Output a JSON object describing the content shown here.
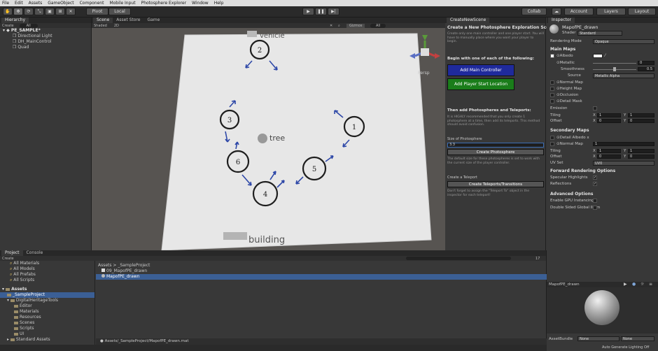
{
  "menu": [
    "File",
    "Edit",
    "Assets",
    "GameObject",
    "Component",
    "Mobile Input",
    "Photosphere Explorer",
    "Window",
    "Help"
  ],
  "toolbar": {
    "pivot": "Pivot",
    "local": "Local",
    "collab": "Collab",
    "account": "Account",
    "layers": "Layers",
    "layout": "Layout"
  },
  "hierarchy": {
    "tab": "Hierarchy",
    "create": "Create",
    "search": "All",
    "scene": "PE_SAMPLE*",
    "items": [
      "Directional Light",
      "DH_MainControl",
      "Quad"
    ]
  },
  "scene": {
    "tabs": [
      "Scene",
      "Asset Store",
      "Game"
    ],
    "shading": "Shaded",
    "mode": "2D",
    "gizmos": "Gizmos",
    "gizmo_search": "All",
    "persp": "Persp",
    "labels": {
      "vehicle": "vehicle",
      "tree": "tree",
      "building": "building"
    },
    "nodes": [
      "1",
      "2",
      "3",
      "4",
      "5",
      "6"
    ]
  },
  "create_scene": {
    "tab": "CreateNewScene",
    "title": "Create a New Photosphere Exploration Scene",
    "intro": "Create only one main controller and one player start. You will have to manually place where you want your player to begin.",
    "begin": "Begin with one of each of the following:",
    "add_main": "Add Main Controller",
    "add_player": "Add Player Start Location",
    "then": "Then add Photospheres and Teleports:",
    "then_desc": "It is HIGHLY recommended that you only create 1 photosphere at a time, then add its teleports. This method should avoid confusion.",
    "size_label": "Size of Photosphere",
    "size_value": "3.3",
    "create_photo": "Create Photosphere",
    "photo_desc": "The default size for these photospheres is set to work with the current size of the player controller.",
    "teleport_label": "Create a Teleport",
    "create_teleport": "Create Teleports/Transitions",
    "teleport_desc": "Don't forget to assign the \"Teleport To\" object in the inspector for each teleport!"
  },
  "inspector": {
    "tab": "Inspector",
    "material": "MapofPE_drawn",
    "shader_label": "Shader",
    "shader": "Standard",
    "rendering_mode_label": "Rendering Mode",
    "rendering_mode": "Opaque",
    "main_maps": "Main Maps",
    "albedo": "Albedo",
    "metallic": "Metallic",
    "metallic_val": "0",
    "smoothness": "Smoothness",
    "smoothness_val": "0.5",
    "source": "Source",
    "source_val": "Metallic Alpha",
    "normal_map": "Normal Map",
    "height_map": "Height Map",
    "occlusion": "Occlusion",
    "detail_mask": "Detail Mask",
    "emission": "Emission",
    "tiling": "Tiling",
    "offset": "Offset",
    "x": "X",
    "y": "Y",
    "tile1": "1",
    "off0": "0",
    "secondary": "Secondary Maps",
    "detail_albedo": "Detail Albedo x",
    "detail_normal": "Normal Map",
    "detail_normal_val": "1",
    "uv_set": "UV Set",
    "uv_val": "UV0",
    "forward": "Forward Rendering Options",
    "specular": "Specular Highlights",
    "reflections": "Reflections",
    "advanced": "Advanced Options",
    "gpu": "Enable GPU Instancing",
    "double_sided": "Double Sided Global Illum",
    "preview_title": "MapofPE_drawn",
    "asset_bundle": "AssetBundle",
    "none": "None",
    "auto_gen": "Auto Generate Lighting Off"
  },
  "project": {
    "tabs": [
      "Project",
      "Console"
    ],
    "create": "Create",
    "favorites": [
      "All Materials",
      "All Models",
      "All Prefabs",
      "All Scripts"
    ],
    "assets": "Assets",
    "tree": [
      "_SampleProject",
      "DigitalHeritageTools",
      "Editor",
      "Materials",
      "Resources",
      "Scenes",
      "Scripts",
      "UI",
      "Standard Assets"
    ],
    "breadcrumb": "Assets > _SampleProject",
    "files": [
      "09_MapofPE_drawn",
      "MapofPE_drawn"
    ],
    "path": "Assets/_SampleProject/MapofPE_drawn.mat",
    "count": "17"
  }
}
